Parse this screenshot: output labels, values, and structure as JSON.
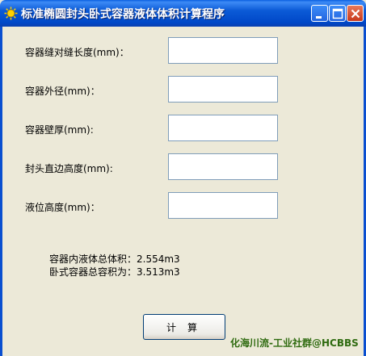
{
  "window": {
    "title": "标准椭圆封头卧式容器液体体积计算程序"
  },
  "form": {
    "fields": [
      {
        "label": "容器缝对缝长度(mm)：",
        "value": ""
      },
      {
        "label": "容器外径(mm)：",
        "value": ""
      },
      {
        "label": "容器壁厚(mm):",
        "value": ""
      },
      {
        "label": "封头直边高度(mm):",
        "value": ""
      },
      {
        "label": "液位高度(mm)：",
        "value": ""
      }
    ]
  },
  "results": {
    "liquid_volume": "容器内液体总体积：2.554m3",
    "total_volume": "卧式容器总容积为：3.513m3"
  },
  "actions": {
    "calc_label": "计算"
  },
  "watermark": "化海川流-工业社群@HCBBS",
  "colors": {
    "titlebar": "#0048c8",
    "window_bg": "#ece9d8",
    "close_button": "#c8391c"
  },
  "icons": [
    "app-icon",
    "minimize-icon",
    "maximize-icon",
    "close-icon"
  ]
}
